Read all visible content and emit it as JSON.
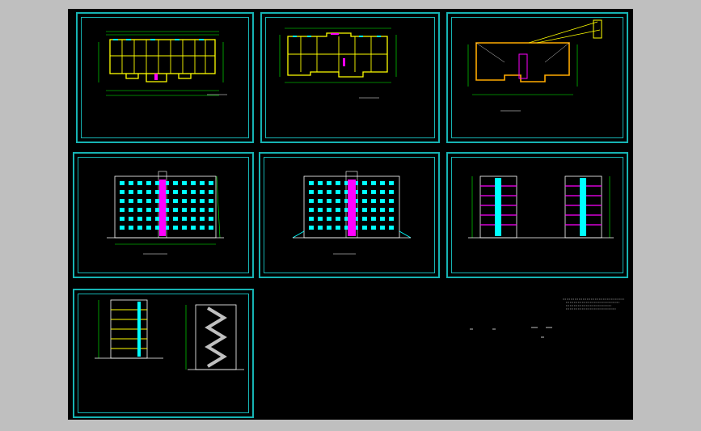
{
  "window": {
    "background": "#bfbfbf",
    "canvas_color": "#000000",
    "frame_color": "#16b3b3"
  },
  "sheets": [
    {
      "id": "s1",
      "kind": "plan-a",
      "caption": "",
      "caption2": ""
    },
    {
      "id": "s2",
      "kind": "plan-b",
      "caption": "",
      "caption2": ""
    },
    {
      "id": "s3",
      "kind": "roof-plan",
      "caption": "",
      "caption2": ""
    },
    {
      "id": "s4",
      "kind": "elevation-front",
      "caption": "",
      "caption2": ""
    },
    {
      "id": "s5",
      "kind": "elevation-back",
      "caption": "",
      "caption2": ""
    },
    {
      "id": "s6",
      "kind": "elevation-sides",
      "caption": "",
      "caption2": ""
    },
    {
      "id": "s7",
      "kind": "sections",
      "caption": "",
      "caption2": ""
    }
  ],
  "colors": {
    "wall": "#ffff00",
    "window": "#00ffff",
    "door": "#ff00ff",
    "dim": "#00ff00",
    "text": "#ffffff",
    "stair": "#c0c0c0"
  }
}
